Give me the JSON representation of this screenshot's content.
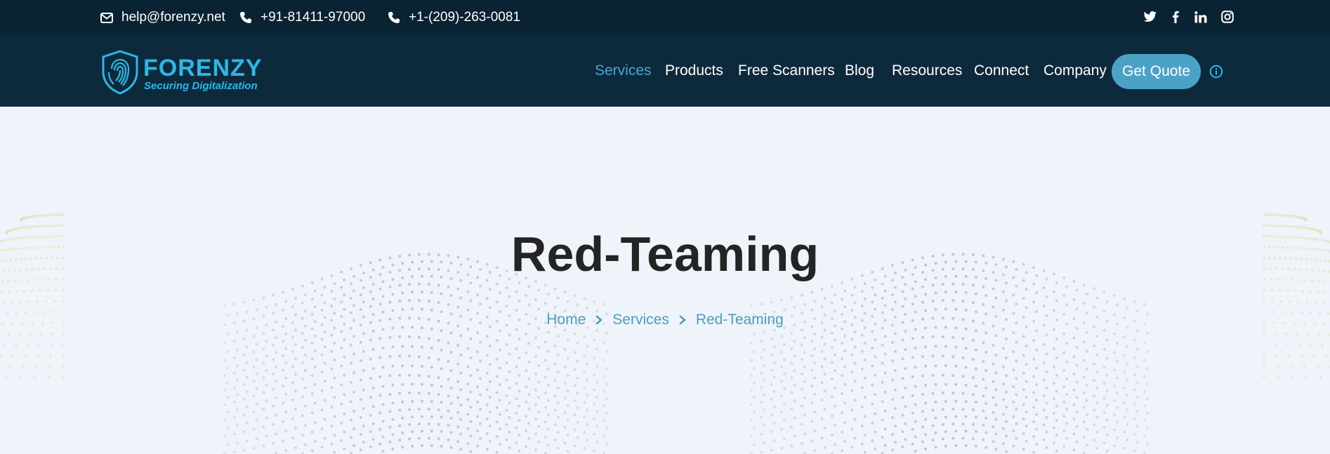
{
  "topbar": {
    "email": "help@forenzy.net",
    "phone_1": "+91-81411-97000",
    "phone_2": "+1-(209)-263-0081",
    "social_icons": [
      "twitter-icon",
      "facebook-icon",
      "linkedin-icon",
      "instagram-icon"
    ]
  },
  "logo": {
    "name": "FORENZY",
    "tagline": "Securing Digitalization"
  },
  "nav": {
    "items": [
      "Services",
      "Products",
      "Free Scanners",
      "Blog",
      "Resources",
      "Connect",
      "Company"
    ],
    "active": "Services",
    "cta": "Get Quote"
  },
  "hero": {
    "title": "Red-Teaming",
    "breadcrumb": [
      "Home",
      "Services",
      "Red-Teaming"
    ]
  },
  "colors": {
    "topbar_bg": "#0a2333",
    "nav_bg": "#0d2a3c",
    "accent": "#4aa3c6",
    "brand": "#2bb8e6",
    "hero_bg": "#eff4fb",
    "title": "#242424"
  }
}
